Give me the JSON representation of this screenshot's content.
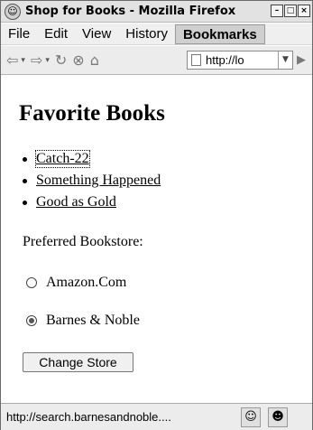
{
  "window": {
    "title": "Shop for Books - Mozilla Firefox",
    "controls": [
      "minimize",
      "maximize",
      "close"
    ]
  },
  "menubar": {
    "items": [
      {
        "label": "File"
      },
      {
        "label": "Edit"
      },
      {
        "label": "View"
      },
      {
        "label": "History"
      },
      {
        "label": "Bookmarks"
      }
    ]
  },
  "navbar": {
    "url": "http://lo",
    "icons": [
      "back-arrow-icon",
      "forward-arrow-icon",
      "reload-icon",
      "stop-icon",
      "home-icon",
      "page-icon",
      "go-arrow-icon"
    ]
  },
  "page": {
    "heading": "Favorite Books",
    "books": [
      {
        "title": "Catch-22"
      },
      {
        "title": "Something Happened"
      },
      {
        "title": "Good as Gold"
      }
    ],
    "bookstore_label": "Preferred Bookstore:",
    "stores": [
      {
        "label": "Amazon.Com",
        "checked": false
      },
      {
        "label": "Barnes & Noble",
        "checked": true
      }
    ],
    "submit_label": "Change Store"
  },
  "statusbar": {
    "text": "http://search.barnesandnoble....",
    "icons": [
      "firefox-icon",
      "smiley-icon"
    ]
  }
}
